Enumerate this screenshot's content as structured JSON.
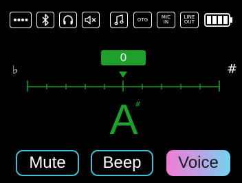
{
  "status_icons": [
    {
      "name": "ellipsis-menu-icon"
    },
    {
      "name": "bluetooth-icon"
    },
    {
      "name": "headphones-icon"
    },
    {
      "name": "speaker-mute-icon"
    },
    {
      "name": "music-note-icon"
    },
    {
      "name": "otg-icon",
      "label": "OTG"
    },
    {
      "name": "mic-in-icon",
      "label_line1": "MIC",
      "label_line2": "IN"
    },
    {
      "name": "line-out-icon",
      "label_line1": "LINE",
      "label_line2": "OUT"
    },
    {
      "name": "battery-icon",
      "level": 1.0
    }
  ],
  "tuner": {
    "cents": "0",
    "flat_symbol": "♭",
    "sharp_symbol": "#",
    "note": "A",
    "note_accidental": "#",
    "accent_color": "#1fa02b"
  },
  "buttons": {
    "mute": "Mute",
    "beep": "Beep",
    "voice": "Voice",
    "active": "voice"
  },
  "colors": {
    "background": "#000000",
    "button_border": "#46bfd6",
    "active_gradient": [
      "#f07bd2",
      "#b7a5e6",
      "#6fd4ee"
    ]
  }
}
